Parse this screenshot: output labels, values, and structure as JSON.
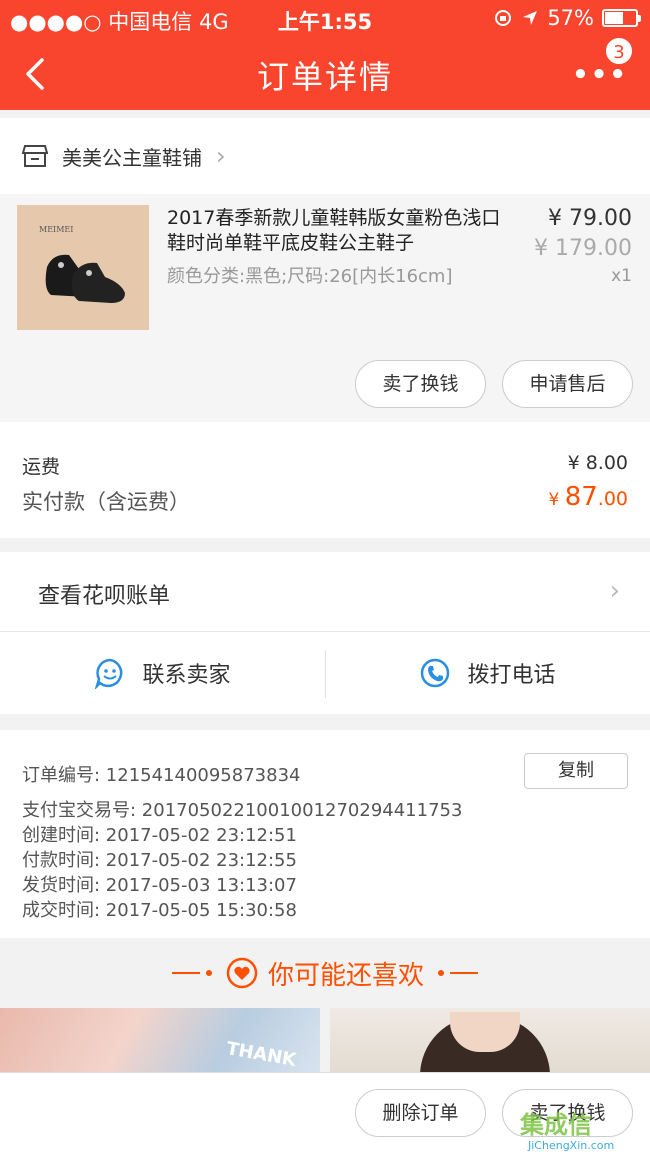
{
  "status_bar": {
    "carrier": "●●●●○ 中国电信  4G",
    "time": "上午1:55",
    "battery": "57%"
  },
  "nav": {
    "title": "订单详情",
    "badge": "3",
    "more": "•••"
  },
  "shop": {
    "name": "美美公主童鞋铺",
    "chevron": "›"
  },
  "item": {
    "image_brand": "MEIMEI",
    "title": "2017春季新款儿童鞋韩版女童粉色浅口鞋时尚单鞋平底皮鞋公主鞋子",
    "spec": "颜色分类:黑色;尺码:26[内长16cm]",
    "price": "¥ 79.00",
    "original_price": "¥ 179.00",
    "qty": "x1",
    "sell_button": "卖了换钱",
    "aftersale_button": "申请售后"
  },
  "fees": {
    "shipping_label": "运费",
    "shipping_value": "¥ 8.00",
    "paid_label": "实付款（含运费）",
    "paid_currency": "¥ ",
    "paid_int": "87",
    "paid_dec": ".00"
  },
  "huabei": {
    "label": "查看花呗账单",
    "chevron": "›"
  },
  "contact": {
    "seller": "联系卖家",
    "phone": "拨打电话"
  },
  "order_info": {
    "order_no": "订单编号:   12154140095873834",
    "copy_button": "复制",
    "alipay_no": "支付宝交易号:   2017050221001001270294411753",
    "created": "创建时间:   2017-05-02 23:12:51",
    "paid": "付款时间:   2017-05-02 23:12:55",
    "shipped": "发货时间:   2017-05-03 13:13:07",
    "completed": "成交时间:   2017-05-05 15:30:58"
  },
  "recommend": {
    "title": "你可能还喜欢",
    "photo_text": "THANK"
  },
  "bottom": {
    "delete_button": "删除订单",
    "sell_button": "卖了换钱"
  },
  "watermark": {
    "logo": "集成信",
    "url": "JiChengXin.com"
  },
  "colors": {
    "brand": "#f9452e",
    "price_accent": "#ff5000",
    "icon_blue": "#2a8fe0"
  }
}
